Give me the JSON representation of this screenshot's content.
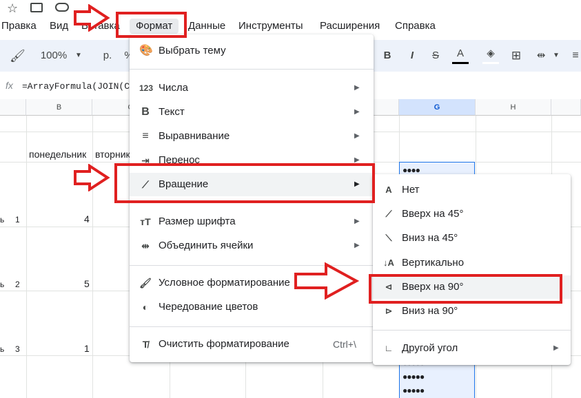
{
  "top_icons": [
    "star-icon",
    "move-to-folder-icon",
    "cloud-saved-icon"
  ],
  "menubar": {
    "items": [
      "Правка",
      "Вид",
      "Вставка",
      "Формат",
      "Данные",
      "Инструменты",
      "Расширения",
      "Справка"
    ],
    "active": "Формат"
  },
  "toolbar": {
    "zoom": "100%",
    "currency": "р.",
    "percent": "%",
    "bold": "B",
    "italic": "I",
    "strike": "S",
    "text_color": "A"
  },
  "formula": {
    "fx": "fx",
    "value": "=ArrayFormula(JOIN(C"
  },
  "columns": [
    "B",
    "C",
    "G",
    "H"
  ],
  "cells": {
    "b_header": "понедельник",
    "c_header": "вторник",
    "row1_label": "ь",
    "row1_num": "1",
    "row1_val": "4",
    "row2_label": "ь",
    "row2_num": "2",
    "row2_val": "5",
    "row3_label": "ь",
    "row3_num": "3",
    "row3_val": "1",
    "g_top": "●●●●",
    "g_bottom1": "●●●●●",
    "g_bottom2": "●●●●●",
    "g_bottom3": "●●●●●"
  },
  "format_menu": {
    "theme": "Выбрать тему",
    "numbers": "Числа",
    "text": "Текст",
    "align": "Выравнивание",
    "wrap": "Перенос",
    "rotate": "Вращение",
    "font_size": "Размер шрифта",
    "merge": "Объединить ячейки",
    "conditional": "Условное форматирование",
    "alternating": "Чередование цветов",
    "clear": "Очистить форматирование",
    "clear_shortcut": "Ctrl+\\",
    "numbers_icon_text": "123",
    "text_icon_text": "B",
    "font_size_icon_text": "тT"
  },
  "rotate_menu": {
    "none": "Нет",
    "up45": "Вверх на 45°",
    "down45": "Вниз на 45°",
    "vertical": "Вертикально",
    "up90": "Вверх на 90°",
    "down90": "Вниз на 90°",
    "custom": "Другой угол"
  },
  "colors": {
    "annotation_red": "#e02020",
    "selection_blue": "#d3e3fd",
    "toolbar_bg": "#edf2fa"
  }
}
